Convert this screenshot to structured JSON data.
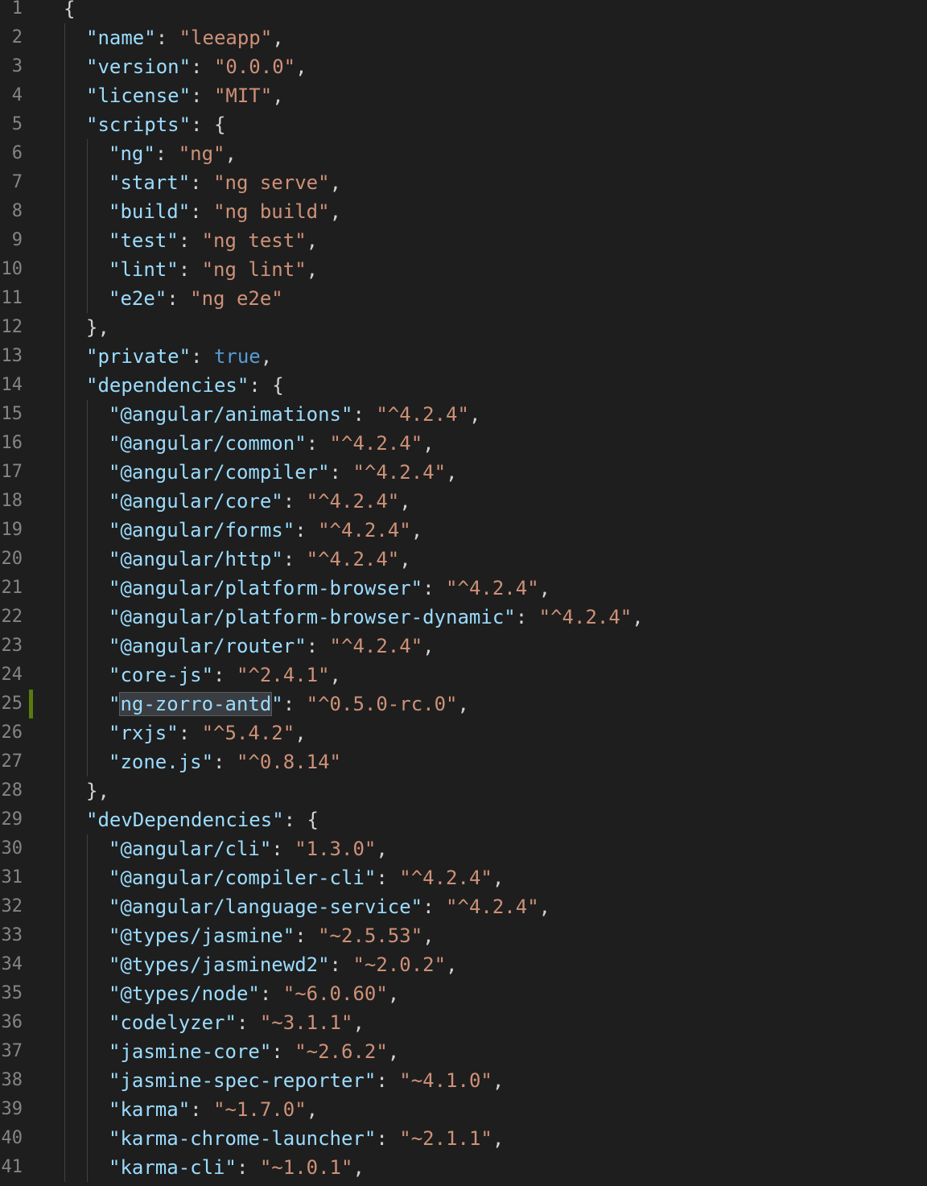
{
  "editor": {
    "colors": {
      "background": "#1e1e1e",
      "key": "#9cdcfe",
      "string": "#ce9178",
      "boolean": "#569cd6",
      "punctuation": "#d4d4d4",
      "line_number": "#858585",
      "gutter_modified": "#587c0c"
    },
    "modified_line": 25,
    "highlighted_word": "ng-zorro-antd",
    "lines": [
      {
        "n": "1",
        "indent": 0,
        "tokens": [
          {
            "t": "{",
            "c": "punc"
          }
        ]
      },
      {
        "n": "2",
        "indent": 1,
        "tokens": [
          {
            "t": "\"name\"",
            "c": "key"
          },
          {
            "t": ": ",
            "c": "punc"
          },
          {
            "t": "\"leeapp\"",
            "c": "str"
          },
          {
            "t": ",",
            "c": "punc"
          }
        ]
      },
      {
        "n": "3",
        "indent": 1,
        "tokens": [
          {
            "t": "\"version\"",
            "c": "key"
          },
          {
            "t": ": ",
            "c": "punc"
          },
          {
            "t": "\"0.0.0\"",
            "c": "str"
          },
          {
            "t": ",",
            "c": "punc"
          }
        ]
      },
      {
        "n": "4",
        "indent": 1,
        "tokens": [
          {
            "t": "\"license\"",
            "c": "key"
          },
          {
            "t": ": ",
            "c": "punc"
          },
          {
            "t": "\"MIT\"",
            "c": "str"
          },
          {
            "t": ",",
            "c": "punc"
          }
        ]
      },
      {
        "n": "5",
        "indent": 1,
        "tokens": [
          {
            "t": "\"scripts\"",
            "c": "key"
          },
          {
            "t": ": {",
            "c": "punc"
          }
        ]
      },
      {
        "n": "6",
        "indent": 2,
        "tokens": [
          {
            "t": "\"ng\"",
            "c": "key"
          },
          {
            "t": ": ",
            "c": "punc"
          },
          {
            "t": "\"ng\"",
            "c": "str"
          },
          {
            "t": ",",
            "c": "punc"
          }
        ]
      },
      {
        "n": "7",
        "indent": 2,
        "tokens": [
          {
            "t": "\"start\"",
            "c": "key"
          },
          {
            "t": ": ",
            "c": "punc"
          },
          {
            "t": "\"ng serve\"",
            "c": "str"
          },
          {
            "t": ",",
            "c": "punc"
          }
        ]
      },
      {
        "n": "8",
        "indent": 2,
        "tokens": [
          {
            "t": "\"build\"",
            "c": "key"
          },
          {
            "t": ": ",
            "c": "punc"
          },
          {
            "t": "\"ng build\"",
            "c": "str"
          },
          {
            "t": ",",
            "c": "punc"
          }
        ]
      },
      {
        "n": "9",
        "indent": 2,
        "tokens": [
          {
            "t": "\"test\"",
            "c": "key"
          },
          {
            "t": ": ",
            "c": "punc"
          },
          {
            "t": "\"ng test\"",
            "c": "str"
          },
          {
            "t": ",",
            "c": "punc"
          }
        ]
      },
      {
        "n": "10",
        "indent": 2,
        "tokens": [
          {
            "t": "\"lint\"",
            "c": "key"
          },
          {
            "t": ": ",
            "c": "punc"
          },
          {
            "t": "\"ng lint\"",
            "c": "str"
          },
          {
            "t": ",",
            "c": "punc"
          }
        ]
      },
      {
        "n": "11",
        "indent": 2,
        "tokens": [
          {
            "t": "\"e2e\"",
            "c": "key"
          },
          {
            "t": ": ",
            "c": "punc"
          },
          {
            "t": "\"ng e2e\"",
            "c": "str"
          }
        ]
      },
      {
        "n": "12",
        "indent": 1,
        "tokens": [
          {
            "t": "},",
            "c": "punc"
          }
        ]
      },
      {
        "n": "13",
        "indent": 1,
        "tokens": [
          {
            "t": "\"private\"",
            "c": "key"
          },
          {
            "t": ": ",
            "c": "punc"
          },
          {
            "t": "true",
            "c": "bool"
          },
          {
            "t": ",",
            "c": "punc"
          }
        ]
      },
      {
        "n": "14",
        "indent": 1,
        "tokens": [
          {
            "t": "\"dependencies\"",
            "c": "key"
          },
          {
            "t": ": {",
            "c": "punc"
          }
        ]
      },
      {
        "n": "15",
        "indent": 2,
        "tokens": [
          {
            "t": "\"@angular/animations\"",
            "c": "key"
          },
          {
            "t": ": ",
            "c": "punc"
          },
          {
            "t": "\"^4.2.4\"",
            "c": "str"
          },
          {
            "t": ",",
            "c": "punc"
          }
        ]
      },
      {
        "n": "16",
        "indent": 2,
        "tokens": [
          {
            "t": "\"@angular/common\"",
            "c": "key"
          },
          {
            "t": ": ",
            "c": "punc"
          },
          {
            "t": "\"^4.2.4\"",
            "c": "str"
          },
          {
            "t": ",",
            "c": "punc"
          }
        ]
      },
      {
        "n": "17",
        "indent": 2,
        "tokens": [
          {
            "t": "\"@angular/compiler\"",
            "c": "key"
          },
          {
            "t": ": ",
            "c": "punc"
          },
          {
            "t": "\"^4.2.4\"",
            "c": "str"
          },
          {
            "t": ",",
            "c": "punc"
          }
        ]
      },
      {
        "n": "18",
        "indent": 2,
        "tokens": [
          {
            "t": "\"@angular/core\"",
            "c": "key"
          },
          {
            "t": ": ",
            "c": "punc"
          },
          {
            "t": "\"^4.2.4\"",
            "c": "str"
          },
          {
            "t": ",",
            "c": "punc"
          }
        ]
      },
      {
        "n": "19",
        "indent": 2,
        "tokens": [
          {
            "t": "\"@angular/forms\"",
            "c": "key"
          },
          {
            "t": ": ",
            "c": "punc"
          },
          {
            "t": "\"^4.2.4\"",
            "c": "str"
          },
          {
            "t": ",",
            "c": "punc"
          }
        ]
      },
      {
        "n": "20",
        "indent": 2,
        "tokens": [
          {
            "t": "\"@angular/http\"",
            "c": "key"
          },
          {
            "t": ": ",
            "c": "punc"
          },
          {
            "t": "\"^4.2.4\"",
            "c": "str"
          },
          {
            "t": ",",
            "c": "punc"
          }
        ]
      },
      {
        "n": "21",
        "indent": 2,
        "tokens": [
          {
            "t": "\"@angular/platform-browser\"",
            "c": "key"
          },
          {
            "t": ": ",
            "c": "punc"
          },
          {
            "t": "\"^4.2.4\"",
            "c": "str"
          },
          {
            "t": ",",
            "c": "punc"
          }
        ]
      },
      {
        "n": "22",
        "indent": 2,
        "tokens": [
          {
            "t": "\"@angular/platform-browser-dynamic\"",
            "c": "key"
          },
          {
            "t": ": ",
            "c": "punc"
          },
          {
            "t": "\"^4.2.4\"",
            "c": "str"
          },
          {
            "t": ",",
            "c": "punc"
          }
        ]
      },
      {
        "n": "23",
        "indent": 2,
        "tokens": [
          {
            "t": "\"@angular/router\"",
            "c": "key"
          },
          {
            "t": ": ",
            "c": "punc"
          },
          {
            "t": "\"^4.2.4\"",
            "c": "str"
          },
          {
            "t": ",",
            "c": "punc"
          }
        ]
      },
      {
        "n": "24",
        "indent": 2,
        "tokens": [
          {
            "t": "\"core-js\"",
            "c": "key"
          },
          {
            "t": ": ",
            "c": "punc"
          },
          {
            "t": "\"^2.4.1\"",
            "c": "str"
          },
          {
            "t": ",",
            "c": "punc"
          }
        ]
      },
      {
        "n": "25",
        "indent": 2,
        "tokens": [
          {
            "t": "\"",
            "c": "key"
          },
          {
            "t": "ng-zorro-antd",
            "c": "key hl"
          },
          {
            "t": "\"",
            "c": "key"
          },
          {
            "t": ": ",
            "c": "punc"
          },
          {
            "t": "\"^0.5.0-rc.0\"",
            "c": "str"
          },
          {
            "t": ",",
            "c": "punc"
          }
        ]
      },
      {
        "n": "26",
        "indent": 2,
        "tokens": [
          {
            "t": "\"rxjs\"",
            "c": "key"
          },
          {
            "t": ": ",
            "c": "punc"
          },
          {
            "t": "\"^5.4.2\"",
            "c": "str"
          },
          {
            "t": ",",
            "c": "punc"
          }
        ]
      },
      {
        "n": "27",
        "indent": 2,
        "tokens": [
          {
            "t": "\"zone.js\"",
            "c": "key"
          },
          {
            "t": ": ",
            "c": "punc"
          },
          {
            "t": "\"^0.8.14\"",
            "c": "str"
          }
        ]
      },
      {
        "n": "28",
        "indent": 1,
        "tokens": [
          {
            "t": "},",
            "c": "punc"
          }
        ]
      },
      {
        "n": "29",
        "indent": 1,
        "tokens": [
          {
            "t": "\"devDependencies\"",
            "c": "key"
          },
          {
            "t": ": {",
            "c": "punc"
          }
        ]
      },
      {
        "n": "30",
        "indent": 2,
        "tokens": [
          {
            "t": "\"@angular/cli\"",
            "c": "key"
          },
          {
            "t": ": ",
            "c": "punc"
          },
          {
            "t": "\"1.3.0\"",
            "c": "str"
          },
          {
            "t": ",",
            "c": "punc"
          }
        ]
      },
      {
        "n": "31",
        "indent": 2,
        "tokens": [
          {
            "t": "\"@angular/compiler-cli\"",
            "c": "key"
          },
          {
            "t": ": ",
            "c": "punc"
          },
          {
            "t": "\"^4.2.4\"",
            "c": "str"
          },
          {
            "t": ",",
            "c": "punc"
          }
        ]
      },
      {
        "n": "32",
        "indent": 2,
        "tokens": [
          {
            "t": "\"@angular/language-service\"",
            "c": "key"
          },
          {
            "t": ": ",
            "c": "punc"
          },
          {
            "t": "\"^4.2.4\"",
            "c": "str"
          },
          {
            "t": ",",
            "c": "punc"
          }
        ]
      },
      {
        "n": "33",
        "indent": 2,
        "tokens": [
          {
            "t": "\"@types/jasmine\"",
            "c": "key"
          },
          {
            "t": ": ",
            "c": "punc"
          },
          {
            "t": "\"~2.5.53\"",
            "c": "str"
          },
          {
            "t": ",",
            "c": "punc"
          }
        ]
      },
      {
        "n": "34",
        "indent": 2,
        "tokens": [
          {
            "t": "\"@types/jasminewd2\"",
            "c": "key"
          },
          {
            "t": ": ",
            "c": "punc"
          },
          {
            "t": "\"~2.0.2\"",
            "c": "str"
          },
          {
            "t": ",",
            "c": "punc"
          }
        ]
      },
      {
        "n": "35",
        "indent": 2,
        "tokens": [
          {
            "t": "\"@types/node\"",
            "c": "key"
          },
          {
            "t": ": ",
            "c": "punc"
          },
          {
            "t": "\"~6.0.60\"",
            "c": "str"
          },
          {
            "t": ",",
            "c": "punc"
          }
        ]
      },
      {
        "n": "36",
        "indent": 2,
        "tokens": [
          {
            "t": "\"codelyzer\"",
            "c": "key"
          },
          {
            "t": ": ",
            "c": "punc"
          },
          {
            "t": "\"~3.1.1\"",
            "c": "str"
          },
          {
            "t": ",",
            "c": "punc"
          }
        ]
      },
      {
        "n": "37",
        "indent": 2,
        "tokens": [
          {
            "t": "\"jasmine-core\"",
            "c": "key"
          },
          {
            "t": ": ",
            "c": "punc"
          },
          {
            "t": "\"~2.6.2\"",
            "c": "str"
          },
          {
            "t": ",",
            "c": "punc"
          }
        ]
      },
      {
        "n": "38",
        "indent": 2,
        "tokens": [
          {
            "t": "\"jasmine-spec-reporter\"",
            "c": "key"
          },
          {
            "t": ": ",
            "c": "punc"
          },
          {
            "t": "\"~4.1.0\"",
            "c": "str"
          },
          {
            "t": ",",
            "c": "punc"
          }
        ]
      },
      {
        "n": "39",
        "indent": 2,
        "tokens": [
          {
            "t": "\"karma\"",
            "c": "key"
          },
          {
            "t": ": ",
            "c": "punc"
          },
          {
            "t": "\"~1.7.0\"",
            "c": "str"
          },
          {
            "t": ",",
            "c": "punc"
          }
        ]
      },
      {
        "n": "40",
        "indent": 2,
        "tokens": [
          {
            "t": "\"karma-chrome-launcher\"",
            "c": "key"
          },
          {
            "t": ": ",
            "c": "punc"
          },
          {
            "t": "\"~2.1.1\"",
            "c": "str"
          },
          {
            "t": ",",
            "c": "punc"
          }
        ]
      },
      {
        "n": "41",
        "indent": 2,
        "tokens": [
          {
            "t": "\"karma-cli\"",
            "c": "key"
          },
          {
            "t": ": ",
            "c": "punc"
          },
          {
            "t": "\"~1.0.1\"",
            "c": "str"
          },
          {
            "t": ",",
            "c": "punc"
          }
        ]
      }
    ]
  }
}
